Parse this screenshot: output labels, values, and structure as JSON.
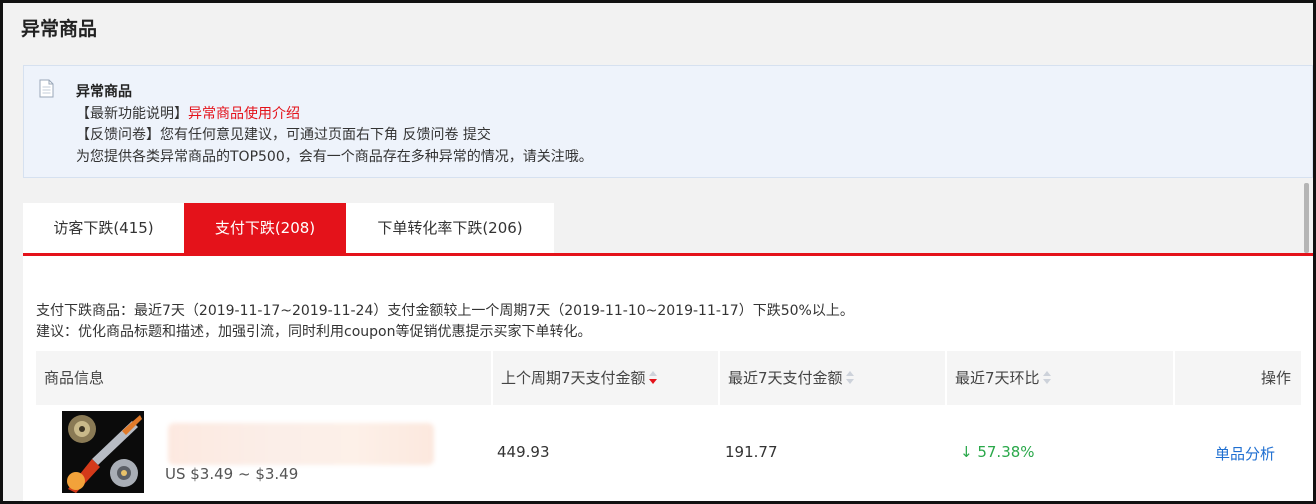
{
  "page": {
    "title": "异常商品"
  },
  "notice": {
    "title": "异常商品",
    "line1_prefix": "【最新功能说明】",
    "line1_link": "异常商品使用介绍",
    "line2": "【反馈问卷】您有任何意见建议，可通过页面右下角 反馈问卷 提交",
    "line3": "为您提供各类异常商品的TOP500，会有一个商品存在多种异常的情况，请关注哦。",
    "icon": "document-icon"
  },
  "tabs": [
    {
      "label": "访客下跌(415)",
      "active": false
    },
    {
      "label": "支付下跌(208)",
      "active": true
    },
    {
      "label": "下单转化率下跌(206)",
      "active": false
    }
  ],
  "description": {
    "line1": "支付下跌商品：最近7天（2019-11-17~2019-11-24）支付金额较上一个周期7天（2019-11-10~2019-11-17）下跌50%以上。",
    "line2": "建议：优化商品标题和描述，加强引流，同时利用coupon等促销优惠提示买家下单转化。"
  },
  "table": {
    "headers": {
      "product_info": "商品信息",
      "prev_amount": "上个周期7天支付金额",
      "recent_amount": "最近7天支付金额",
      "change": "最近7天环比",
      "action": "操作"
    },
    "sort_active_color": "#e4121a",
    "rows": [
      {
        "price": "US $3.49 ~ $3.49",
        "prev_amount": "449.93",
        "recent_amount": "191.77",
        "change": "↓ 57.38%",
        "action": "单品分析"
      }
    ]
  },
  "colors": {
    "accent": "#e4121a",
    "link": "#1f6fd1",
    "down_green": "#2aa84a"
  }
}
